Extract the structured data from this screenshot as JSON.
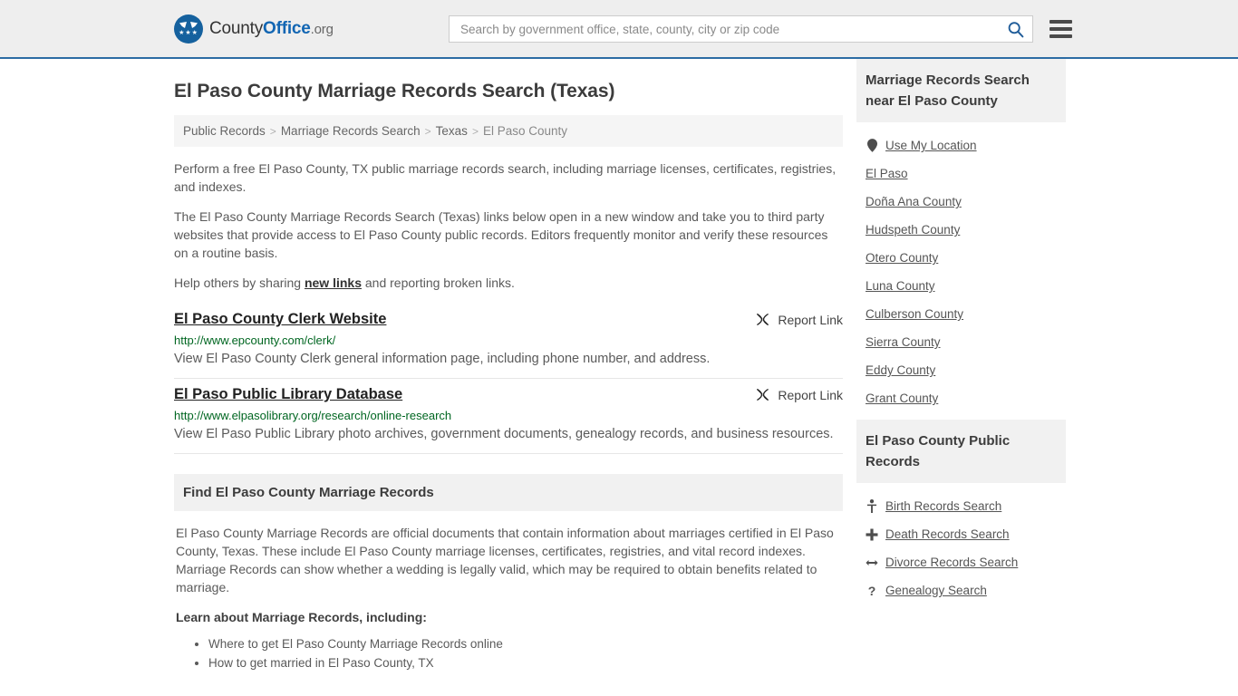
{
  "header": {
    "logo": {
      "part1": "County",
      "part2": "Office",
      "part3": ".org",
      "icon": "eagle-seal-logo",
      "stars": "★★★"
    },
    "search": {
      "placeholder": "Search by government office, state, county, city or zip code",
      "value": "",
      "button_icon": "search-icon"
    },
    "menu_icon": "hamburger-menu-icon",
    "accent_color": "#2c6ca4",
    "background_color": "#eeeeee"
  },
  "main": {
    "title": "El Paso County Marriage Records Search (Texas)",
    "breadcrumb": [
      {
        "label": "Public Records",
        "current": false
      },
      {
        "label": "Marriage Records Search",
        "current": false
      },
      {
        "label": "Texas",
        "current": false
      },
      {
        "label": "El Paso County",
        "current": true
      }
    ],
    "breadcrumb_separator": ">",
    "intro": {
      "p1": "Perform a free El Paso County, TX public marriage records search, including marriage licenses, certificates, registries, and indexes.",
      "p2": "The El Paso County Marriage Records Search (Texas) links below open in a new window and take you to third party websites that provide access to El Paso County public records. Editors frequently monitor and verify these resources on a routine basis.",
      "p3_before": "Help others by sharing ",
      "p3_link": "new links",
      "p3_after": " and reporting broken links."
    },
    "report_link_label": "Report Link",
    "report_link_icon": "broken-link-icon",
    "results": [
      {
        "title": "El Paso County Clerk Website",
        "url": "http://www.epcounty.com/clerk/",
        "description": "View El Paso County Clerk general information page, including phone number, and address."
      },
      {
        "title": "El Paso Public Library Database",
        "url": "http://www.elpasolibrary.org/research/online-research",
        "description": "View El Paso Public Library photo archives, government documents, genealogy records, and business resources."
      }
    ],
    "find_section": {
      "heading": "Find El Paso County Marriage Records",
      "body": "El Paso County Marriage Records are official documents that contain information about marriages certified in El Paso County, Texas. These include El Paso County marriage licenses, certificates, registries, and vital record indexes. Marriage Records can show whether a wedding is legally valid, which may be required to obtain benefits related to marriage.",
      "lead": "Learn about Marriage Records, including:",
      "bullets": [
        "Where to get El Paso County Marriage Records online",
        "How to get married in El Paso County, TX"
      ]
    }
  },
  "sidebar": {
    "panels": [
      {
        "heading": "Marriage Records Search near El Paso County",
        "items": [
          {
            "label": "Use My Location",
            "icon": "map-pin-icon"
          },
          {
            "label": "El Paso",
            "icon": ""
          },
          {
            "label": "Doña Ana County",
            "icon": ""
          },
          {
            "label": "Hudspeth County",
            "icon": ""
          },
          {
            "label": "Otero County",
            "icon": ""
          },
          {
            "label": "Luna County",
            "icon": ""
          },
          {
            "label": "Culberson County",
            "icon": ""
          },
          {
            "label": "Sierra County",
            "icon": ""
          },
          {
            "label": "Eddy County",
            "icon": ""
          },
          {
            "label": "Grant County",
            "icon": ""
          }
        ]
      },
      {
        "heading": "El Paso County Public Records",
        "items": [
          {
            "label": "Birth Records Search",
            "icon": "baby-icon",
            "glyph": "Ɣ"
          },
          {
            "label": "Death Records Search",
            "icon": "cross-icon",
            "glyph": "✚"
          },
          {
            "label": "Divorce Records Search",
            "icon": "left-right-arrow-icon",
            "glyph": "↔"
          },
          {
            "label": "Genealogy Search",
            "icon": "question-mark-icon",
            "glyph": "?"
          }
        ]
      }
    ]
  }
}
